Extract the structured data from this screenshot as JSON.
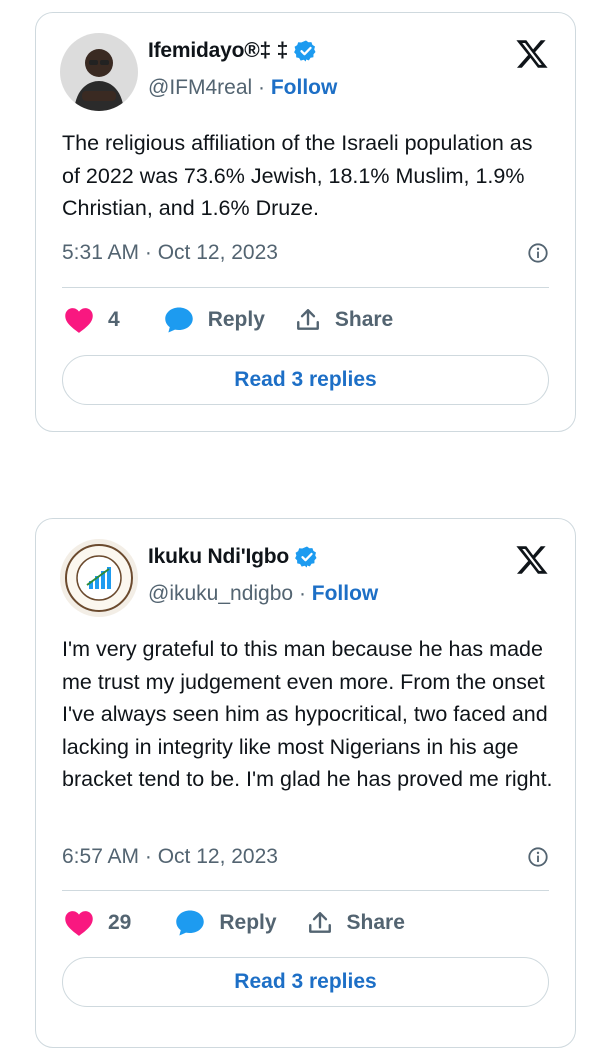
{
  "tweets": [
    {
      "name": "Ifemidayo®‡ ‡",
      "handle": "@IFM4real",
      "separator": "·",
      "follow": "Follow",
      "text": "The religious affiliation of the Israeli population as of 2022 was 73.6% Jewish, 18.1% Muslim, 1.9% Christian, and 1.6% Druze.",
      "time": "5:31 AM · Oct 12, 2023",
      "likes": "4",
      "reply": "Reply",
      "share": "Share",
      "read_replies": "Read 3 replies",
      "avatar_icon": "profile-photo"
    },
    {
      "name": "Ikuku Ndi'Igbo",
      "handle": "@ikuku_ndigbo",
      "separator": "·",
      "follow": "Follow",
      "text": "I'm very grateful to this man because he has made me trust my judgement even more. From the onset I've always seen him as hypocritical, two faced and lacking in integrity like most Nigerians in his age bracket tend to be. I'm glad he has proved me right.",
      "time": "6:57 AM · Oct 12, 2023",
      "likes": "29",
      "reply": "Reply",
      "share": "Share",
      "read_replies": "Read 3 replies",
      "avatar_icon": "association-logo"
    }
  ],
  "colors": {
    "heart": "#f91880",
    "reply_bubble": "#1d9bf0",
    "link": "#1d6fc6",
    "verified": "#1d9bf0",
    "muted": "#536471",
    "border": "#cfd9de"
  },
  "icons": [
    "verified-badge-icon",
    "x-logo-icon",
    "info-icon",
    "heart-icon",
    "reply-icon",
    "share-icon"
  ]
}
